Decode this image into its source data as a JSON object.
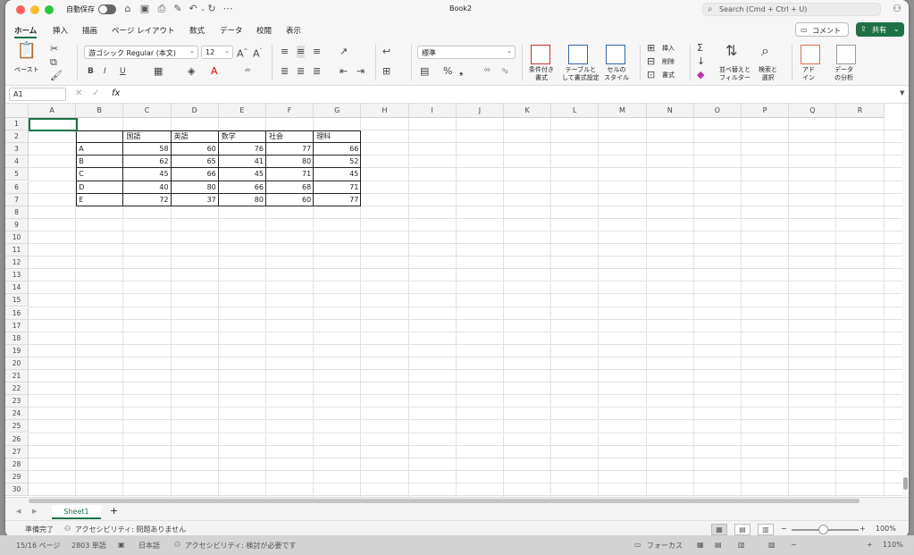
{
  "window": {
    "title": "Book2",
    "autosave_label": "自動保存",
    "search_placeholder": "Search (Cmd + Ctrl + U)"
  },
  "ribbon_tabs": [
    "ホーム",
    "挿入",
    "描画",
    "ページ レイアウト",
    "数式",
    "データ",
    "校閲",
    "表示"
  ],
  "header_buttons": {
    "comment": "コメント",
    "share": "共有"
  },
  "ribbon": {
    "paste_label": "ペースト",
    "font_name": "游ゴシック Regular (本文)",
    "font_size": "12",
    "number_format": "標準",
    "conditional_format_label": "条件付き\n書式",
    "table_format_label": "テーブルと\nして書式設定",
    "cell_style_label": "セルの\nスタイル",
    "insert_label": "挿入",
    "delete_label": "削除",
    "format_label": "書式",
    "sort_filter_label": "並べ替えと\nフィルター",
    "find_select_label": "検索と\n選択",
    "addins_label": "アド\nイン",
    "data_analysis_label": "データ\nの分析",
    "bold": "B",
    "italic": "I",
    "underline": "U",
    "percent": "%",
    "comma": "❟"
  },
  "formula_bar": {
    "name_box": "A1",
    "fx": "fx",
    "formula": ""
  },
  "columns": [
    "A",
    "B",
    "C",
    "D",
    "E",
    "F",
    "G",
    "H",
    "I",
    "J",
    "K",
    "L",
    "M",
    "N",
    "O",
    "P",
    "Q",
    "R"
  ],
  "rows": [
    "1",
    "2",
    "3",
    "4",
    "5",
    "6",
    "7",
    "8",
    "9",
    "10",
    "11",
    "12",
    "13",
    "14",
    "15",
    "16",
    "17",
    "18",
    "19",
    "20",
    "21",
    "22",
    "23",
    "24",
    "25",
    "26",
    "27",
    "28",
    "29",
    "30"
  ],
  "table": {
    "headers": [
      "国語",
      "英語",
      "数学",
      "社会",
      "理科"
    ],
    "rows": [
      {
        "label": "A",
        "values": [
          "58",
          "60",
          "76",
          "77",
          "66"
        ]
      },
      {
        "label": "B",
        "values": [
          "62",
          "65",
          "41",
          "80",
          "52"
        ]
      },
      {
        "label": "C",
        "values": [
          "45",
          "66",
          "45",
          "71",
          "45"
        ]
      },
      {
        "label": "D",
        "values": [
          "40",
          "80",
          "66",
          "68",
          "71"
        ]
      },
      {
        "label": "E",
        "values": [
          "72",
          "37",
          "80",
          "60",
          "77"
        ]
      }
    ]
  },
  "sheet_tabs": [
    "Sheet1"
  ],
  "add_sheet": "+",
  "status": {
    "ready": "準備完了",
    "accessibility": "アクセシビリティ: 問題ありません",
    "zoom": "100%"
  },
  "underbar": {
    "page": "15/16 ページ",
    "words": "2803 単語",
    "language": "日本語",
    "accessibility": "アクセシビリティ: 検討が必要です",
    "focus": "フォーカス",
    "zoom": "110%"
  },
  "accent_color": "#1e7145"
}
